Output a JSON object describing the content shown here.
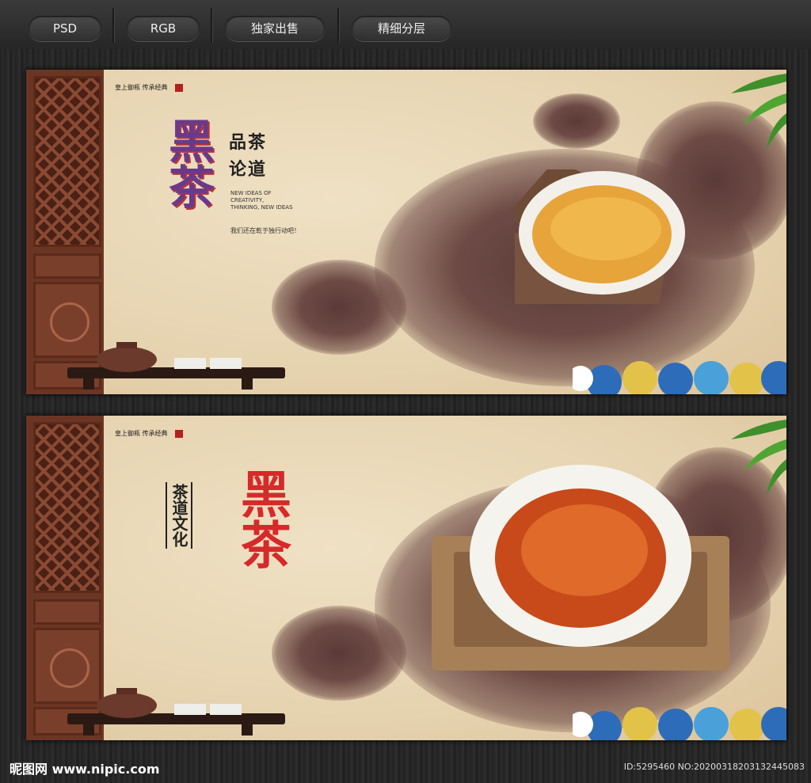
{
  "toolbar": {
    "tags": [
      "PSD",
      "RGB",
      "独家出售",
      "精细分层"
    ]
  },
  "panel1": {
    "title": "黑茶",
    "subtitle_line1": "品茶",
    "subtitle_line2": "论道",
    "slogan_en_1": "NEW IDEAS OF",
    "slogan_en_2": "CREATIVITY,",
    "slogan_en_3": "THINKING, NEW IDEAS",
    "slogan_cn": "我们还在乾于独行动吧！",
    "top_left_tag": "皇上御瓶 传承经典"
  },
  "panel2": {
    "title": "黑茶",
    "vertical_label": "茶道文化",
    "top_left_tag": "皇上御瓶 传承经典"
  },
  "footer": {
    "site": "昵图网 www.nipic.com",
    "id_text": "ID:5295460 NO:20200318203132445083"
  },
  "colors": {
    "title_red": "#d62a2a",
    "door_brown": "#6b3524",
    "paper": "#e6d3b0"
  }
}
